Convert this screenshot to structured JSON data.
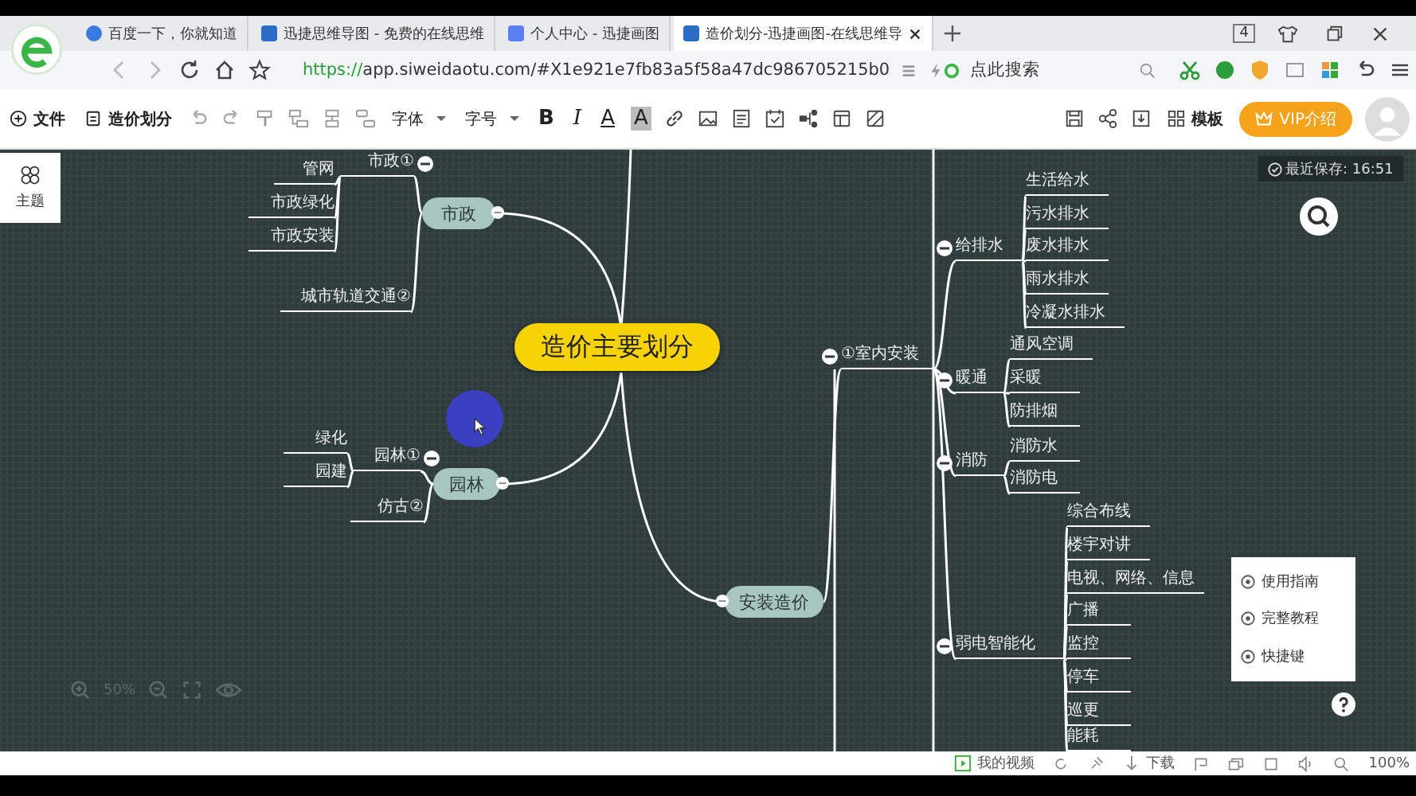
{
  "browser": {
    "tabs": [
      {
        "title": "百度一下，你就知道",
        "selected": false
      },
      {
        "title": "迅捷思维导图 - 免费的在线思维",
        "selected": false
      },
      {
        "title": "个人中心 - 迅捷画图",
        "selected": false
      },
      {
        "title": "造价划分-迅捷画图-在线思维导",
        "selected": true
      }
    ],
    "window_count": "4",
    "url_secure": "https://",
    "url_rest": "app.siweidaotu.com/#X1e921e7fb83a5f58a47dc986705215b0",
    "search_placeholder": "点此搜索"
  },
  "toolbar": {
    "file": "文件",
    "document": "造价划分",
    "font": "字体",
    "font_size": "字号",
    "bold": "B",
    "italic": "I",
    "font_color": "A",
    "highlight": "A",
    "template": "模板",
    "vip": "VIP介绍"
  },
  "sidebar": {
    "theme": "主题"
  },
  "save_status": "最近保存: 16:51",
  "mindmap": {
    "root": "造价主要划分",
    "branches": [
      {
        "label": "市政",
        "expanded": true,
        "children": [
          {
            "label": "市政①",
            "expanded": true,
            "children": [
              {
                "label": "管网"
              },
              {
                "label": "市政绿化"
              },
              {
                "label": "市政安装"
              }
            ]
          },
          {
            "label": "城市轨道交通②"
          }
        ]
      },
      {
        "label": "园林",
        "expanded": true,
        "children": [
          {
            "label": "园林①",
            "expanded": true,
            "children": [
              {
                "label": "绿化"
              },
              {
                "label": "园建"
              }
            ]
          },
          {
            "label": "仿古②"
          }
        ]
      },
      {
        "label": "安装造价",
        "expanded": true,
        "children": [
          {
            "label": "①室内安装",
            "expanded": true,
            "children": [
              {
                "label": "给排水",
                "expanded": true,
                "children": [
                  {
                    "label": "生活给水"
                  },
                  {
                    "label": "污水排水"
                  },
                  {
                    "label": "废水排水"
                  },
                  {
                    "label": "雨水排水"
                  },
                  {
                    "label": "冷凝水排水"
                  }
                ]
              },
              {
                "label": "暖通",
                "expanded": true,
                "children": [
                  {
                    "label": "通风空调"
                  },
                  {
                    "label": "采暖"
                  },
                  {
                    "label": "防排烟"
                  }
                ]
              },
              {
                "label": "消防",
                "expanded": true,
                "children": [
                  {
                    "label": "消防水"
                  },
                  {
                    "label": "消防电"
                  }
                ]
              },
              {
                "label": "弱电智能化",
                "expanded": true,
                "children": [
                  {
                    "label": "综合布线"
                  },
                  {
                    "label": "楼宇对讲"
                  },
                  {
                    "label": "电视、网络、信息"
                  },
                  {
                    "label": "广播"
                  },
                  {
                    "label": "监控"
                  },
                  {
                    "label": "停车"
                  },
                  {
                    "label": "巡更"
                  },
                  {
                    "label": "能耗"
                  }
                ]
              }
            ]
          }
        ]
      }
    ]
  },
  "zoom": "50%",
  "help": {
    "items": [
      "使用指南",
      "完整教程",
      "快捷键"
    ]
  },
  "status_bar": {
    "videos": "我的视频",
    "download": "下载",
    "zoom": "100%"
  }
}
